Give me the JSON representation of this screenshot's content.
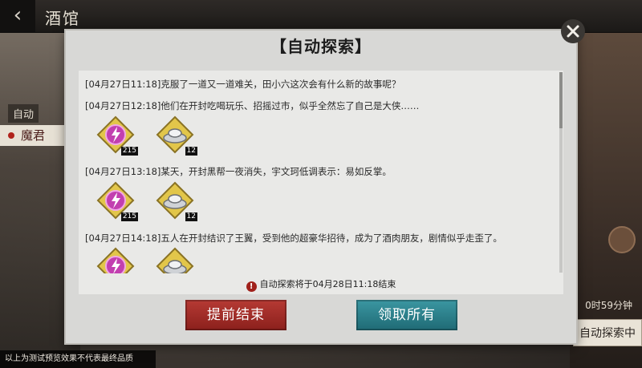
{
  "header": {
    "title": "酒馆",
    "back_icon": "back-chevron-icon"
  },
  "background": {
    "left_label": "自动",
    "left_tag": "魔君",
    "right_time": "0时59分钟",
    "right_button": "自动探索中"
  },
  "footer_note": "以上为测试预览效果不代表最终品质",
  "modal": {
    "title": "【自动探索】",
    "log": [
      {
        "time": "[04月27日11:18]",
        "text": "克服了一道又一道难关，田小六这次会有什么新的故事呢？",
        "rewards": []
      },
      {
        "time": "[04月27日12:18]",
        "text": "他们在开封吃喝玩乐、招摇过市，似乎全然忘了自己是大侠……",
        "rewards": [
          {
            "icon": "purple-lightning-gem-icon",
            "count": "215"
          },
          {
            "icon": "silver-ingot-icon",
            "count": "12"
          }
        ]
      },
      {
        "time": "[04月27日13:18]",
        "text": "某天，开封黑帮一夜消失，宇文珂低调表示：易如反掌。",
        "rewards": [
          {
            "icon": "purple-lightning-gem-icon",
            "count": "215"
          },
          {
            "icon": "silver-ingot-icon",
            "count": "12"
          }
        ]
      },
      {
        "time": "[04月27日14:18]",
        "text": "五人在开封结识了王翼，受到他的超豪华招待，成为了酒肉朋友，剧情似乎走歪了。",
        "rewards": [
          {
            "icon": "purple-lightning-gem-icon",
            "count": ""
          },
          {
            "icon": "silver-ingot-icon",
            "count": ""
          }
        ]
      }
    ],
    "status": "自动探索将于04月28日11:18结束",
    "buttons": {
      "end_early": "提前结束",
      "claim_all": "领取所有"
    }
  },
  "colors": {
    "end_button": "#a02c27",
    "claim_button": "#2b7f8a",
    "gem": "#c23fb0",
    "frame": "#e2c64a"
  }
}
